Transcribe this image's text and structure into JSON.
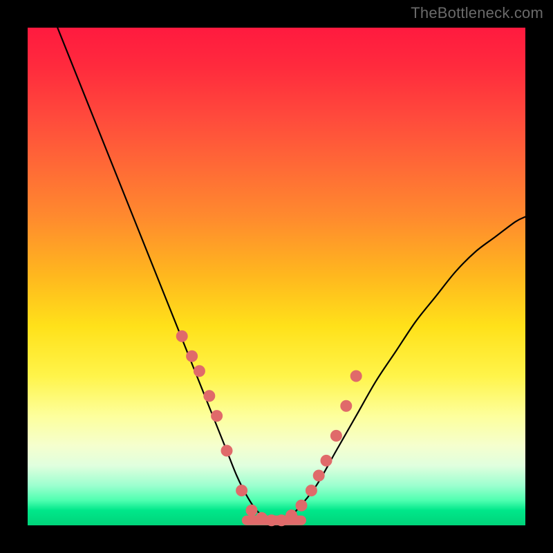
{
  "watermark": "TheBottleneck.com",
  "chart_data": {
    "type": "line",
    "title": "",
    "xlabel": "",
    "ylabel": "",
    "xlim": [
      0,
      100
    ],
    "ylim": [
      0,
      100
    ],
    "grid": false,
    "legend": null,
    "series": [
      {
        "name": "bottleneck-curve",
        "x": [
          6,
          10,
          14,
          18,
          22,
          26,
          30,
          34,
          36,
          38,
          40,
          42,
          44,
          46,
          48,
          50,
          52,
          54,
          58,
          62,
          66,
          70,
          74,
          78,
          82,
          86,
          90,
          94,
          98,
          100
        ],
        "y": [
          100,
          90,
          80,
          70,
          60,
          50,
          40,
          30,
          25,
          20,
          15,
          10,
          6,
          3,
          1.5,
          1,
          1.5,
          3,
          8,
          15,
          22,
          29,
          35,
          41,
          46,
          51,
          55,
          58,
          61,
          62
        ]
      }
    ],
    "markers": {
      "name": "highlighted-points",
      "color": "#e06a6a",
      "points_x": [
        31,
        33,
        34.5,
        36.5,
        38,
        40,
        43,
        45,
        47,
        49,
        51,
        53,
        55,
        57,
        58.5,
        60,
        62,
        64,
        66
      ],
      "points_y": [
        38,
        34,
        31,
        26,
        22,
        15,
        7,
        3,
        1.5,
        1,
        1,
        2,
        4,
        7,
        10,
        13,
        18,
        24,
        30
      ]
    },
    "flat_segment": {
      "name": "valley-floor",
      "color": "#e06a6a",
      "x_start": 44,
      "x_end": 55,
      "y": 1
    },
    "background_gradient": {
      "top": "#ff1a3f",
      "mid": "#ffe11a",
      "bottom": "#00d47a"
    }
  }
}
